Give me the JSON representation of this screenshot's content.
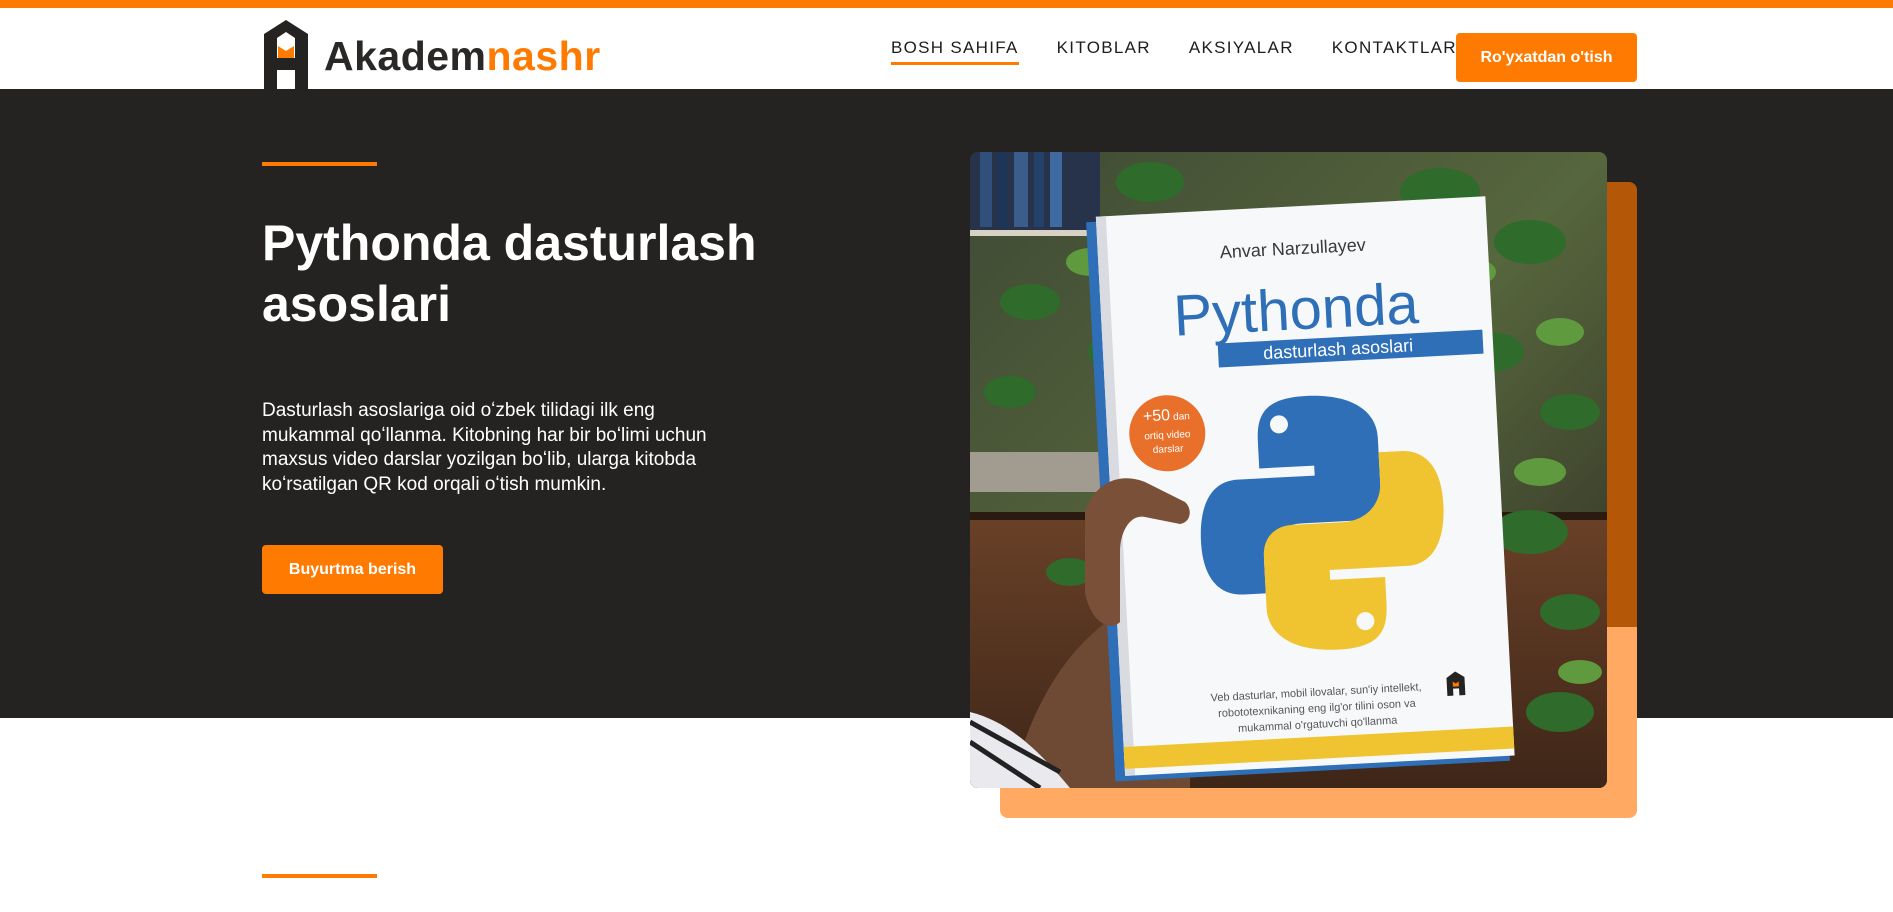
{
  "brand": {
    "part1": "Akadem",
    "part2": "nashr"
  },
  "nav": {
    "items": [
      {
        "label": "BOSH SAHIFA",
        "active": true
      },
      {
        "label": "KITOBLAR",
        "active": false
      },
      {
        "label": "AKSIYALAR",
        "active": false
      },
      {
        "label": "KONTAKTLAR",
        "active": false
      }
    ],
    "register_label": "Ro'yxatdan o'tish"
  },
  "hero": {
    "title": "Pythonda dasturlash asoslari",
    "description": "Dasturlash asoslariga oid oʻzbek tilidagi ilk eng mukammal qoʻllanma. Kitobning har bir boʻlimi uchun maxsus video darslar yozilgan boʻlib, ularga kitobda koʻrsatilgan QR kod orqali oʻtish mumkin.",
    "cta_label": "Buyurtma berish"
  },
  "book": {
    "author": "Anvar Narzullayev",
    "title": "Pythonda",
    "subtitle": "dasturlash asoslari",
    "badge_line1": "+50",
    "badge_line2": "dan",
    "badge_line3": "ortiq video",
    "badge_line4": "darslar",
    "blurb_line1": "Veb dasturlar, mobil ilovalar, sun'iy intellekt,",
    "blurb_line2": "robototexnikaning eng ilg'or tilini oson va",
    "blurb_line3": "mukammal o'rgatuvchi qo'llanma"
  },
  "colors": {
    "accent": "#ff7a00",
    "dark": "#252321",
    "python_blue": "#2e6fb7",
    "python_yellow": "#f0c431"
  }
}
